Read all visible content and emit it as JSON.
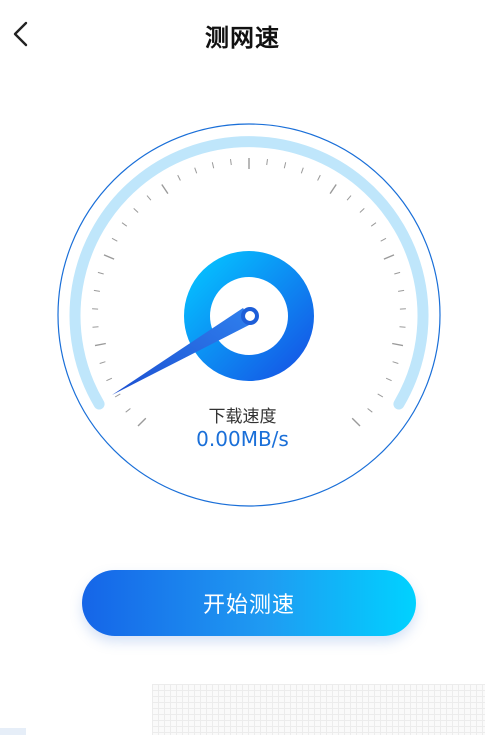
{
  "header": {
    "title": "测网速",
    "back_icon": "chevron-left-icon"
  },
  "gauge": {
    "label": "下载速度",
    "value": "0.00MB/s",
    "speed_fraction": 0.0,
    "colors": {
      "outer_ring": "#1a6fd8",
      "arc": "#bfe6fb",
      "ticks": "#9a9a9a",
      "hub_light": "#05b6ff",
      "hub_dark": "#1560e8",
      "needle": "#1a52d6"
    }
  },
  "actions": {
    "start_label": "开始测速"
  },
  "colors": {
    "accent": "#1a6fd8",
    "button_start": "#1565e8",
    "button_end": "#00d2ff"
  }
}
